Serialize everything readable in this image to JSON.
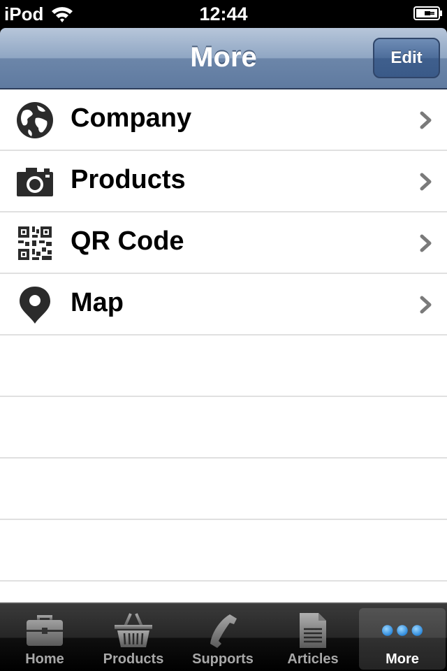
{
  "status_bar": {
    "carrier": "iPod",
    "time": "12:44"
  },
  "nav": {
    "title": "More",
    "edit_label": "Edit"
  },
  "list": {
    "items": [
      {
        "label": "Company",
        "icon": "globe-icon"
      },
      {
        "label": "Products",
        "icon": "camera-icon"
      },
      {
        "label": "QR Code",
        "icon": "qr-code-icon"
      },
      {
        "label": "Map",
        "icon": "map-pin-icon"
      }
    ]
  },
  "tabs": {
    "items": [
      {
        "label": "Home",
        "icon": "briefcase-icon"
      },
      {
        "label": "Products",
        "icon": "basket-icon"
      },
      {
        "label": "Supports",
        "icon": "phone-icon"
      },
      {
        "label": "Articles",
        "icon": "document-icon"
      },
      {
        "label": "More",
        "icon": "more-dots-icon",
        "selected": true
      }
    ]
  },
  "colors": {
    "nav_bar": "#6c86a9",
    "tab_selected_dots": "#3aa0f0",
    "separator": "#e0e0e0"
  }
}
